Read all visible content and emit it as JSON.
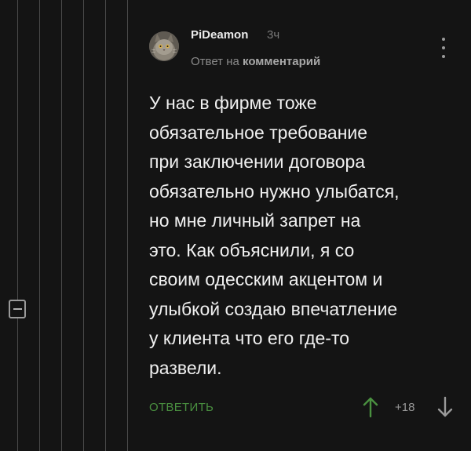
{
  "comment": {
    "author": "PiDeamon",
    "time": "3ч",
    "reply_prefix": "Ответ на ",
    "reply_link": "комментарий",
    "text_lines": [
      "У нас в фирме тоже",
      "обязательное требование",
      "при заключении договора",
      "обязательно нужно улыбатся,",
      "но мне личный запрет на",
      "это. Как объяснили, я со",
      "своим одесским акцентом и",
      "улыбкой создаю впечатление",
      "у клиента что его где-то",
      "развели."
    ],
    "reply_label": "ОТВЕТИТЬ",
    "rating": "+18"
  },
  "icons": {
    "avatar": "cat-avatar",
    "collapse": "minus-square-icon",
    "more": "vertical-dots-icon",
    "upvote": "arrow-up-icon",
    "downvote": "arrow-down-icon"
  },
  "colors": {
    "background": "#141414",
    "text": "#f0f0f0",
    "muted": "#8a8a8a",
    "reply_accent": "#4a9140",
    "upvote": "#4a9140",
    "downvote": "#9a9a9a",
    "thread_line": "#4a4a4a"
  }
}
